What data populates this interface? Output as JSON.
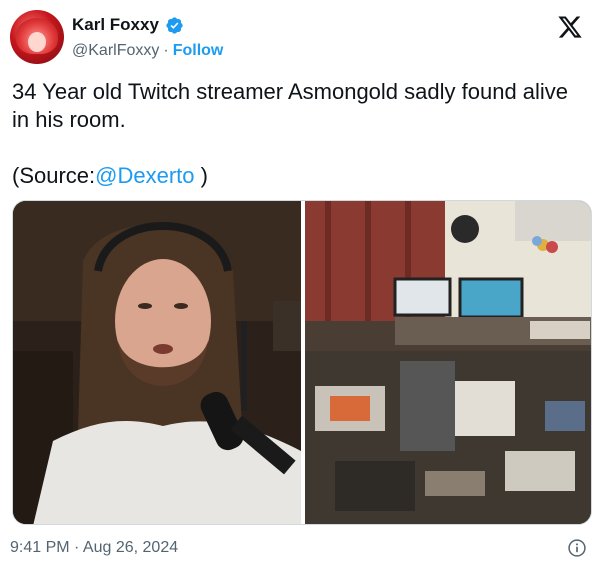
{
  "author": {
    "display_name": "Karl Foxxy",
    "handle": "@KarlFoxxy",
    "separator": "·",
    "follow_label": "Follow"
  },
  "icons": {
    "verified": "verified-badge-icon",
    "platform": "x-logo-icon",
    "info": "info-icon"
  },
  "colors": {
    "accent": "#1d9bf0",
    "text": "#0f1419",
    "muted": "#536471"
  },
  "tweet": {
    "line1": "34 Year old Twitch streamer Asmongold sadly found alive in his room.",
    "source_prefix": "(Source:",
    "source_mention": "@Dexerto",
    "source_suffix": " )"
  },
  "timestamp": "9:41 PM · Aug 26, 2024"
}
